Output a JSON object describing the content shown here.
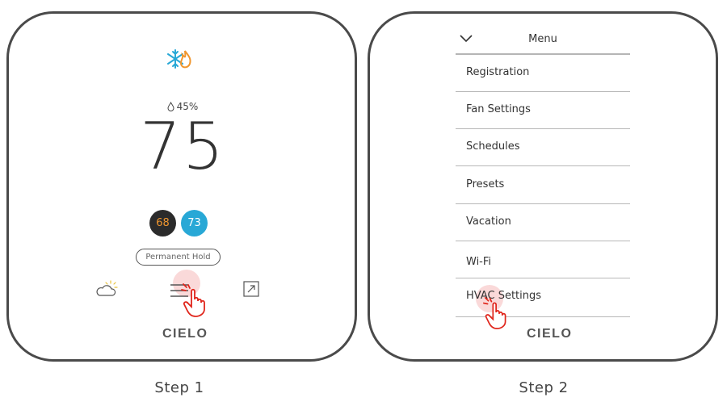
{
  "step1": {
    "caption": "Step 1",
    "humidity": "45%",
    "temperature": "75",
    "heat_setpoint": "68",
    "cool_setpoint": "73",
    "hold_label": "Permanent Hold",
    "logo": "CIELO",
    "icons": [
      "heat-cool-mode-icon",
      "humidity-drop-icon",
      "weather-icon",
      "menu-icon",
      "expand-icon",
      "tap-hand-icon"
    ]
  },
  "step2": {
    "caption": "Step 2",
    "menu_title": "Menu",
    "items": [
      "Registration",
      "Fan Settings",
      "Schedules",
      "Presets",
      "Vacation",
      "Wi-Fi",
      "HVAC Settings"
    ],
    "logo": "CIELO",
    "icons": [
      "chevron-down-icon",
      "tap-hand-icon"
    ]
  },
  "colors": {
    "heat": "#f0962e",
    "cool": "#28a8d6",
    "tap_highlight": "#f5aaaa",
    "hand": "#e0251b"
  }
}
